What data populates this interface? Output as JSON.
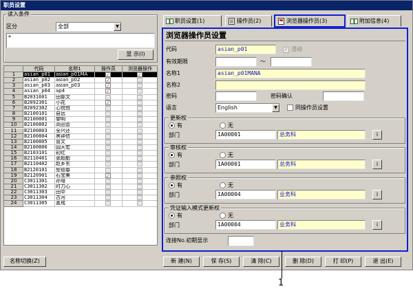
{
  "window": {
    "title": "职员设置"
  },
  "filter": {
    "group_title": "读入条件",
    "category_label": "区分",
    "category_value": "全部",
    "search_value": "*",
    "display_button": "显 示(I)"
  },
  "table": {
    "headers": [
      "",
      "代码",
      "名称1",
      "操作员",
      "浏览器操作"
    ],
    "rows": [
      {
        "n": "1",
        "code": "asian_p01",
        "name": "asian_p01MA",
        "op": "on",
        "br": "on",
        "sel": true
      },
      {
        "n": "2",
        "code": "asian_p02",
        "name": "asian_p02",
        "op": "on",
        "br": "off"
      },
      {
        "n": "3",
        "code": "asian_p03",
        "name": "asian_p03",
        "op": "on",
        "br": "off"
      },
      {
        "n": "4",
        "code": "asian_p04",
        "name": "ap4",
        "op": "on",
        "br": "off"
      },
      {
        "n": "5",
        "code": "B2031601",
        "name": "田部文",
        "op": "off",
        "br": "off"
      },
      {
        "n": "6",
        "code": "B2092301",
        "name": "小花",
        "op": "on",
        "br": "off"
      },
      {
        "n": "7",
        "code": "B2092302",
        "name": "心悦悦",
        "op": "off",
        "br": "off"
      },
      {
        "n": "8",
        "code": "B2100101",
        "name": "县远",
        "op": "off",
        "br": "off"
      },
      {
        "n": "9",
        "code": "B2100801",
        "name": "黎明",
        "op": "off",
        "br": "off"
      },
      {
        "n": "10",
        "code": "B2100802",
        "name": "高田会",
        "op": "off",
        "br": "off"
      },
      {
        "n": "11",
        "code": "B2100803",
        "name": "全兴还",
        "op": "off",
        "br": "off"
      },
      {
        "n": "12",
        "code": "B2100804",
        "name": "黑钟信",
        "op": "off",
        "br": "off"
      },
      {
        "n": "13",
        "code": "B2100805",
        "name": "冒文",
        "op": "off",
        "br": "off"
      },
      {
        "n": "14",
        "code": "B2100806",
        "name": "园天宏",
        "op": "off",
        "br": "off"
      },
      {
        "n": "15",
        "code": "B2103101",
        "name": "初红",
        "op": "off",
        "br": "off"
      },
      {
        "n": "16",
        "code": "B2110401",
        "name": "张超舶",
        "op": "off",
        "br": "off"
      },
      {
        "n": "17",
        "code": "B2110402",
        "name": "赵乡东",
        "op": "off",
        "br": "off"
      },
      {
        "n": "18",
        "code": "B2120101",
        "name": "型德春",
        "op": "off",
        "br": "off"
      },
      {
        "n": "19",
        "code": "B2120901",
        "name": "石宝美",
        "op": "on",
        "br": "off"
      },
      {
        "n": "20",
        "code": "C3011301",
        "name": "孙培",
        "op": "off",
        "br": "off"
      },
      {
        "n": "21",
        "code": "C3011302",
        "name": "时力心",
        "op": "off",
        "br": "off"
      },
      {
        "n": "22",
        "code": "C3011303",
        "name": "田中",
        "op": "off",
        "br": "off"
      },
      {
        "n": "23",
        "code": "C3011304",
        "name": "古河",
        "op": "off",
        "br": "off"
      },
      {
        "n": "24",
        "code": "C3011305",
        "name": "盖戒",
        "op": "off",
        "br": "off"
      }
    ]
  },
  "tabs": [
    {
      "label": "职员设置(1)"
    },
    {
      "label": "操作员(2)"
    },
    {
      "label": "浏览器操作员(3)"
    },
    {
      "label": "附加信息(4)"
    }
  ],
  "panel": {
    "title": "浏览器操作员设置",
    "code_label": "代码",
    "code_value": "asian_p01",
    "active_label": "活动",
    "period_label": "有效期限",
    "period_sep": "～",
    "name1_label": "名称1",
    "name1_value": "asian_p01MANA",
    "name2_label": "名称2",
    "password_label": "密码",
    "password_confirm_label": "密码确认",
    "language_label": "语言",
    "language_value": "English",
    "same_as_operator_label": "同操作员设置",
    "sections": [
      {
        "title": "更新权",
        "yes": "有",
        "no": "无",
        "dept_label": "部门",
        "dept_code": "1A00001",
        "dept_name": "总务科",
        "pick": "i"
      },
      {
        "title": "审核权",
        "yes": "有",
        "no": "无",
        "dept_label": "部门",
        "dept_code": "1A00001",
        "dept_name": "总务科",
        "pick": "i"
      },
      {
        "title": "参照权",
        "yes": "有",
        "no": "无",
        "dept_label": "部门",
        "dept_code": "1A00004",
        "dept_name": "业务科",
        "pick": "i"
      },
      {
        "title": "凭证输入模式更新权",
        "yes": "有",
        "no": "无",
        "dept_label": "部门",
        "dept_code": "1A00004",
        "dept_name": "业务科",
        "pick": "i"
      }
    ],
    "continuous_label": "连接No.初期显示"
  },
  "footer": {
    "toggle_name": "名称切换(Z)",
    "new": "新 建(N)",
    "save": "保 存(S)",
    "clear": "清 除(C)",
    "delete": "删 除(D)",
    "print": "打 印(P)",
    "exit": "退 出(E)"
  },
  "callout": {
    "number": "1"
  },
  "colors": {
    "highlight": "#1020d0",
    "title_bar": "#0a246a",
    "input_yellow": "#ffffcc"
  }
}
